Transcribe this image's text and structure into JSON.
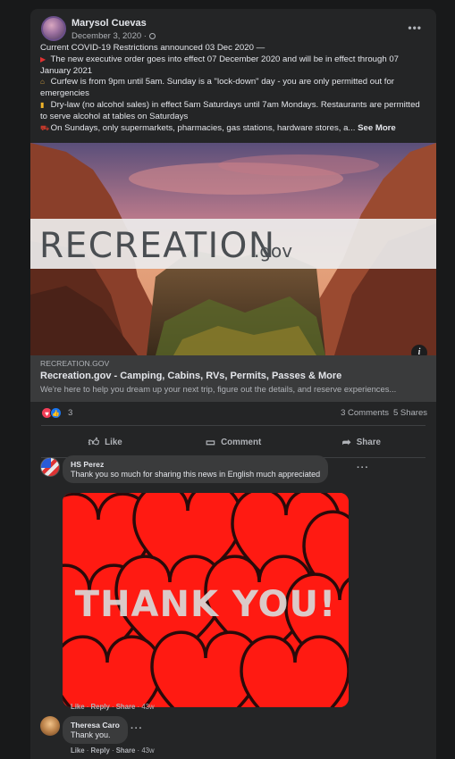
{
  "post": {
    "author": "Marysol Cuevas",
    "date": "December 3, 2020 ·",
    "more_icon": "more-horizontal-icon",
    "text_lines": [
      "Current COVID-19 Restrictions announced 03 Dec 2020 —",
      "The new executive order goes into effect 07 December 2020 and will be in effect through 07 January 2021",
      "Curfew is from 9pm until 5am. Sunday is a \"lock-down\" day - you are only permitted out for emergencies",
      "Dry-law (no alcohol sales) in effect 5am Saturdays until 7am Mondays. Restaurants are permitted to serve alcohol at tables on Saturdays",
      "On Sundays, only supermarkets, pharmacies, gas stations, hardware stores, a..."
    ],
    "see_more": "See More"
  },
  "link": {
    "logo_main": "RECREATION",
    "logo_suffix": ".gov",
    "domain": "RECREATION.GOV",
    "title": "Recreation.gov - Camping, Cabins, RVs, Permits, Passes & More",
    "description": "We're here to help you dream up your next trip, figure out the details, and reserve experiences...",
    "info_label": "i"
  },
  "stats": {
    "reaction_count": "3",
    "comments": "3 Comments",
    "shares": "5 Shares"
  },
  "actions": {
    "like": "Like",
    "comment": "Comment",
    "share": "Share"
  },
  "comments": [
    {
      "name": "HS Perez",
      "text": "Thank you so much for sharing this news in English much appreciated",
      "image_text": "THANK YOU!",
      "like": "Like",
      "reply": "Reply",
      "share": "Share",
      "time": "43w"
    },
    {
      "name": "Theresa Caro",
      "text": "Thank you.",
      "like": "Like",
      "reply": "Reply",
      "share": "Share",
      "time": "43w"
    }
  ],
  "colors": {
    "background": "#18191a",
    "card": "#242526",
    "bubble": "#3a3b3c",
    "text": "#e4e6eb",
    "secondary": "#b0b3b8",
    "like_blue": "#1877f2",
    "love_red": "#f33e58"
  }
}
